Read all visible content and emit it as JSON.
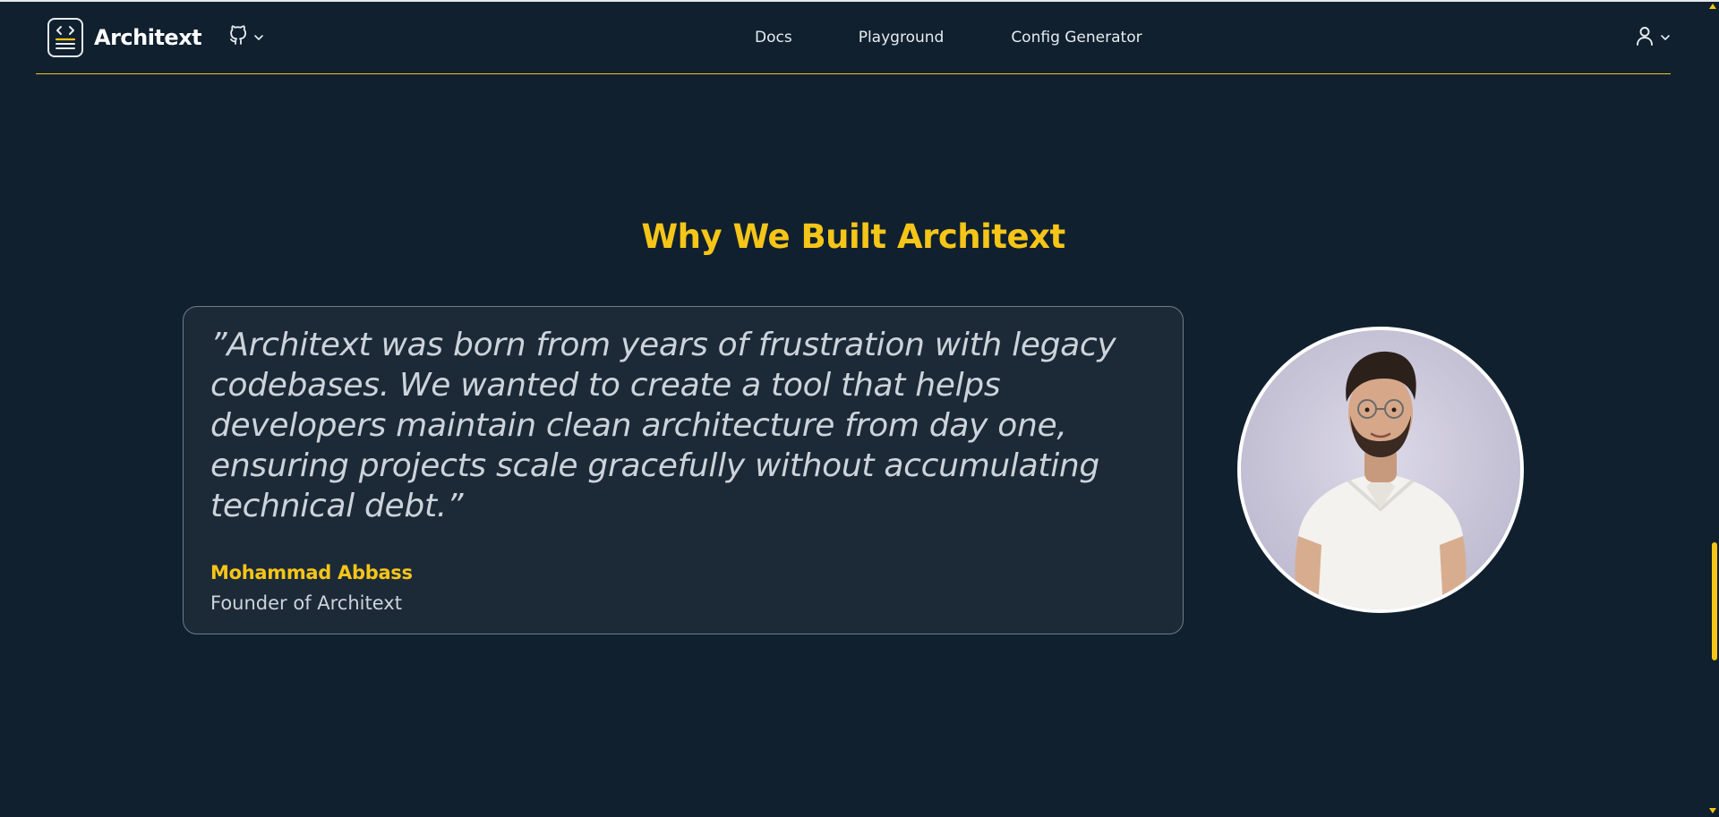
{
  "colors": {
    "background": "#10202f",
    "accent": "#f5c518",
    "card": "#1c2a38",
    "text": "#e7ebef"
  },
  "navbar": {
    "brand": "Architext",
    "logo_icon": "code-document-icon",
    "github_icon": "github-icon",
    "links": [
      {
        "label": "Docs"
      },
      {
        "label": "Playground"
      },
      {
        "label": "Config Generator"
      }
    ],
    "user_icon": "user-icon"
  },
  "section": {
    "title": "Why We Built Architext"
  },
  "testimonial": {
    "quote": "”Architext was born from years of frustration with legacy codebases. We wanted to create a tool that helps developers maintain clean architecture from day one, ensuring projects scale gracefully without accumulating technical debt.”",
    "author": "Mohammad Abbass",
    "role": "Founder of Architext"
  },
  "scrollbar": {
    "position_fraction": 0.72
  }
}
